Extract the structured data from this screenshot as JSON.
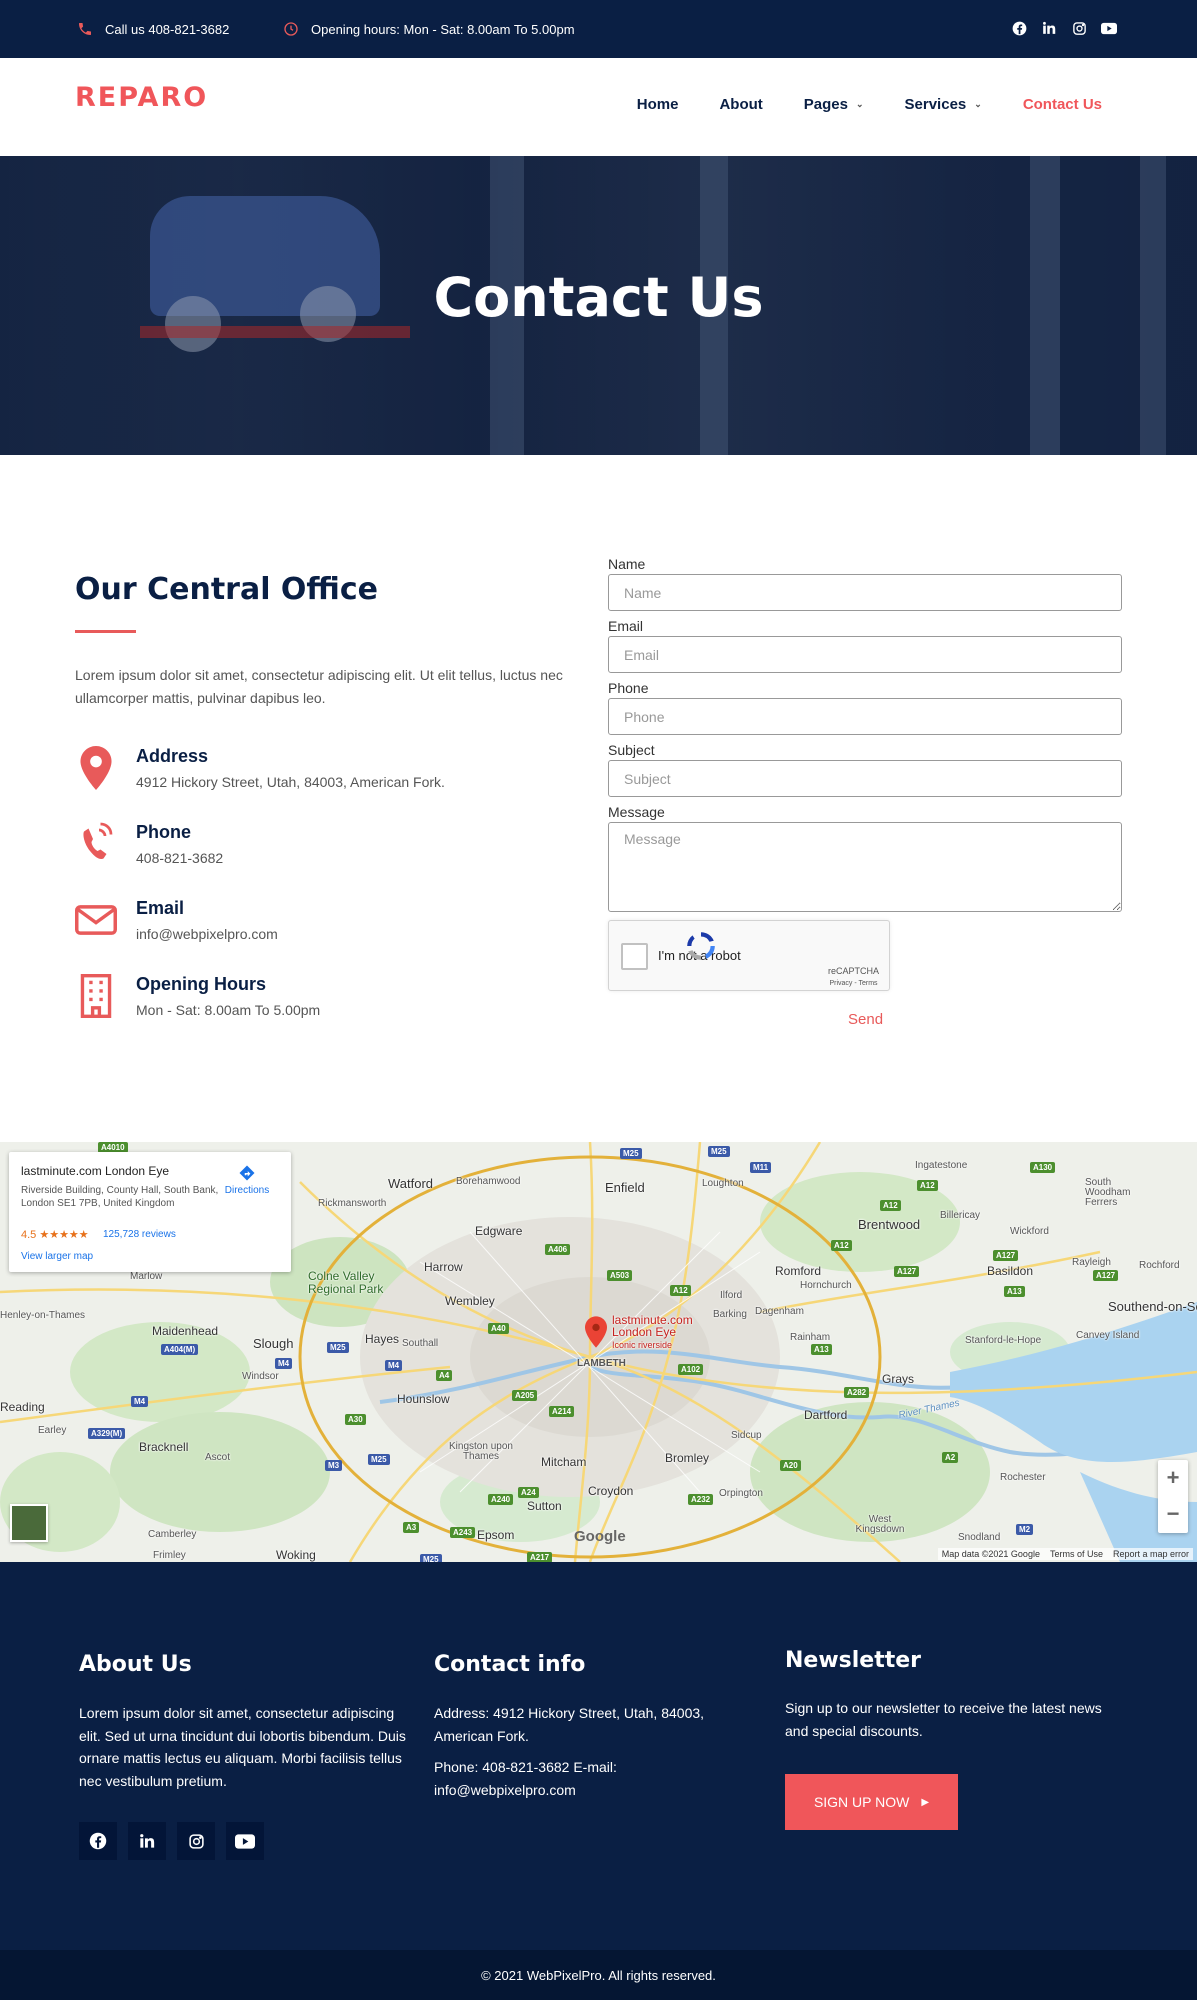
{
  "topbar": {
    "phone": "Call us 408-821-3682",
    "hours": "Opening hours: Mon - Sat: 8.00am To 5.00pm",
    "social": [
      "facebook-icon",
      "linkedin-icon",
      "instagram-icon",
      "youtube-icon"
    ]
  },
  "header": {
    "logo": "REPARO",
    "nav": [
      {
        "label": "Home"
      },
      {
        "label": "About"
      },
      {
        "label": "Pages"
      },
      {
        "label": "Services"
      },
      {
        "label": "Contact Us"
      }
    ]
  },
  "hero": {
    "title": "Contact Us"
  },
  "office": {
    "title": "Our Central Office",
    "description": "Lorem ipsum dolor sit amet, consectetur adipiscing elit. Ut elit tellus, luctus nec ullamcorper mattis, pulvinar dapibus leo.",
    "items": [
      {
        "title": "Address",
        "value": "4912 Hickory Street, Utah, 84003, American Fork."
      },
      {
        "title": "Phone",
        "value": "408-821-3682"
      },
      {
        "title": "Email",
        "value": "info@webpixelpro.com"
      },
      {
        "title": "Opening Hours",
        "value": "Mon - Sat: 8.00am To 5.00pm"
      }
    ]
  },
  "form": {
    "fields": [
      {
        "label": "Name",
        "placeholder": "Name"
      },
      {
        "label": "Email",
        "placeholder": "Email"
      },
      {
        "label": "Phone",
        "placeholder": "Phone"
      },
      {
        "label": "Subject",
        "placeholder": "Subject"
      },
      {
        "label": "Message",
        "placeholder": "Message"
      }
    ],
    "captcha_label": "I'm not a robot",
    "captcha_brand": "reCAPTCHA",
    "captcha_links": "Privacy - Terms",
    "send": "Send"
  },
  "map": {
    "card_name": "lastminute.com London Eye",
    "card_address": "Riverside Building, County Hall, South Bank, London SE1 7PB, United Kingdom",
    "rating": "4.5 ★★★★★",
    "reviews": "125,728 reviews",
    "larger": "View larger map",
    "directions": "Directions",
    "pin_title": "lastminute.com London Eye",
    "pin_sub": "Iconic riverside",
    "google": "Google",
    "attribution": [
      "Map data ©2021 Google",
      "Terms of Use",
      "Report a map error"
    ],
    "zoom_in": "+",
    "zoom_out": "−",
    "places": [
      "Watford",
      "Borehamwood",
      "Enfield",
      "Loughton",
      "Ingatestone",
      "South Woodham Ferrers",
      "Rickmansworth",
      "Edgware",
      "Brentwood",
      "Billericay",
      "Wickford",
      "Harrow",
      "Romford",
      "Hornchurch",
      "Basildon",
      "Rayleigh",
      "Rochford",
      "Marlow",
      "Colne Valley Regional Park",
      "Wembley",
      "Ilford",
      "Barking",
      "Dagenham",
      "Southend-on-Sea",
      "Henley-on-Thames",
      "Maidenhead",
      "Slough",
      "Hayes",
      "Southall",
      "LAMBETH",
      "Rainham",
      "Stanford-le-Hope",
      "Canvey Island",
      "Windsor",
      "Hounslow",
      "Grays",
      "Reading",
      "Earley",
      "Dartford",
      "Bracknell",
      "Ascot",
      "Kingston upon Thames",
      "Mitcham",
      "Bromley",
      "Sidcup",
      "River Thames",
      "Croydon",
      "Orpington",
      "Rochester",
      "Sutton",
      "Camberley",
      "Epsom",
      "West Kingsdown",
      "Snodland",
      "Frimley",
      "Woking"
    ],
    "roads": [
      "A4010",
      "M25",
      "M25",
      "M11",
      "A130",
      "A12",
      "A12",
      "A12",
      "A406",
      "A503",
      "A12",
      "A127",
      "A127",
      "A127",
      "A13",
      "A40",
      "A404(M)",
      "M25",
      "A13",
      "M4",
      "M4",
      "A4",
      "A102",
      "A205",
      "A282",
      "A214",
      "M4",
      "A329(M)",
      "A30",
      "A2",
      "A20",
      "M3",
      "M25",
      "A240",
      "A24",
      "A232",
      "A3",
      "A243",
      "M25",
      "A217",
      "M2"
    ]
  },
  "footer": {
    "about_title": "About Us",
    "about_text": "Lorem ipsum dolor sit amet, consectetur adipiscing elit. Sed ut urna tincidunt dui lobortis bibendum. Duis ornare mattis lectus eu aliquam. Morbi facilisis tellus nec vestibulum pretium.",
    "contact_title": "Contact info",
    "contact_address": "Address: 4912 Hickory Street, Utah, 84003, American Fork.",
    "contact_phone": "Phone: 408-821-3682 E-mail: info@webpixelpro.com",
    "newsletter_title": "Newsletter",
    "newsletter_text": "Sign up to our newsletter to receive the latest news and special discounts.",
    "signup": "SIGN UP NOW",
    "copyright": "© 2021 WebPixelPro. All rights reserved."
  },
  "colors": {
    "navy": "#0a1f44",
    "accent": "#f0565a"
  }
}
